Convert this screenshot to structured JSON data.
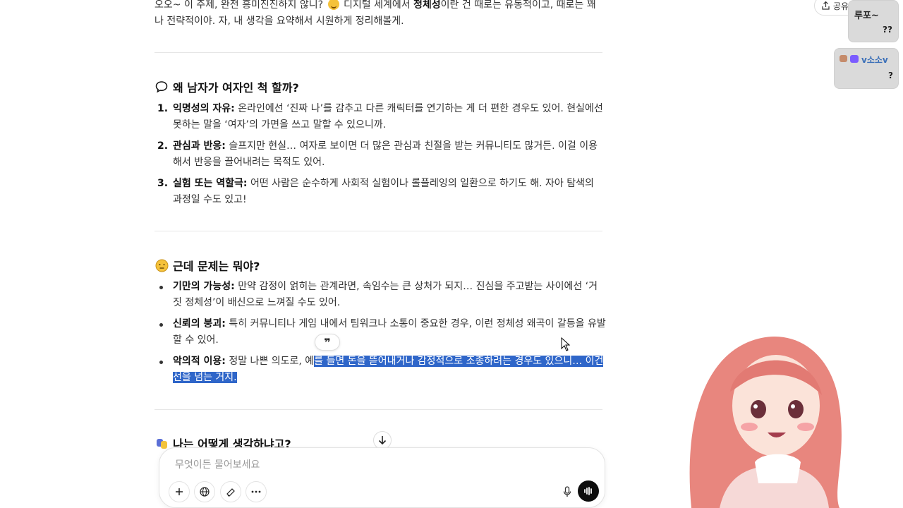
{
  "intro": {
    "part1": "오오~ 이 주제, 완전 흥미진진하지 않니? ",
    "part2": " 디지털 세계에서 ",
    "bold": "정체성",
    "part3": "이란 건 때로는 유동적이고, 때로는 꽤 나 전략적이야. 자, 내 생각을 요약해서 시원하게 정리해볼게."
  },
  "section1": {
    "title": "왜 남자가 여자인 척 할까?",
    "items": [
      {
        "num": "1.",
        "term": "익명성의 자유:",
        "text": " 온라인에선 ‘진짜 나’를 감추고 다른 캐릭터를 연기하는 게 더 편한 경우도 있어. 현실에선 못하는 말을 ‘여자’의 가면을 쓰고 말할 수 있으니까."
      },
      {
        "num": "2.",
        "term": "관심과 반응:",
        "text": " 슬프지만 현실… 여자로 보이면 더 많은 관심과 친절을 받는 커뮤니티도 많거든. 이걸 이용해서 반응을 끌어내려는 목적도 있어."
      },
      {
        "num": "3.",
        "term": "실험 또는 역할극:",
        "text": " 어떤 사람은 순수하게 사회적 실험이나 롤플레잉의 일환으로 하기도 해. 자아 탐색의 과정일 수도 있고!"
      }
    ]
  },
  "section2": {
    "title": "근데 문제는 뭐야?",
    "items": [
      {
        "term": "기만의 가능성:",
        "text": " 만약 감정이 얽히는 관계라면, 속임수는 큰 상처가 되지… 진심을 주고받는 사이에선 ‘거짓 정체성’이 배신으로 느껴질 수도 있어."
      },
      {
        "term": "신뢰의 붕괴:",
        "text": " 특히 커뮤니티나 게임 내에서 팀워크나 소통이 중요한 경우, 이런 정체성 왜곡이 갈등을 유발할 수 있어."
      },
      {
        "term": "악의적 이용:",
        "text": " 정말 나쁜 의도로, 예",
        "selected": "를 들면 돈을 뜯어내거나 감정적으로 조종하려는 경우도 있으니… 이건 선을 넘는 거지."
      }
    ]
  },
  "section3": {
    "title": "나는 어떻게 생각하냐고?"
  },
  "quote_button": "❞",
  "composer": {
    "placeholder": "무엇이든 물어보세요"
  },
  "share_button": "공유하기",
  "overlay": {
    "panel1_line1": "루포~",
    "panel1_line2": "??",
    "panel2_line1": "v소소v",
    "panel2_line2": "?"
  },
  "colors": {
    "selection": "#2f66c9",
    "voice_button": "#0d0d0d"
  }
}
